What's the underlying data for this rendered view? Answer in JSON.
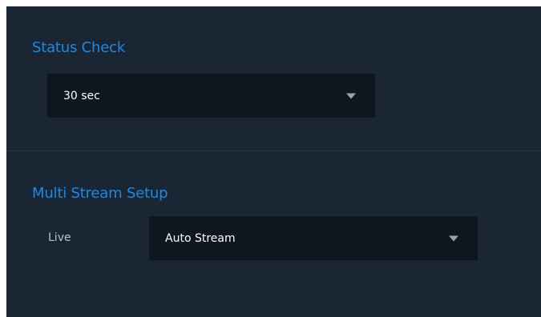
{
  "status_check": {
    "title": "Status Check",
    "selected": "30 sec",
    "icon": "chevron-down-icon"
  },
  "multi_stream_setup": {
    "title": "Multi Stream Setup",
    "live_label": "Live",
    "selected": "Auto Stream",
    "icon": "chevron-down-icon"
  },
  "colors": {
    "panel_background": "#1a2633",
    "select_background": "#0e1620",
    "section_title": "#1e88e5",
    "label_text": "#b8c0c8",
    "value_text": "#ffffff"
  }
}
